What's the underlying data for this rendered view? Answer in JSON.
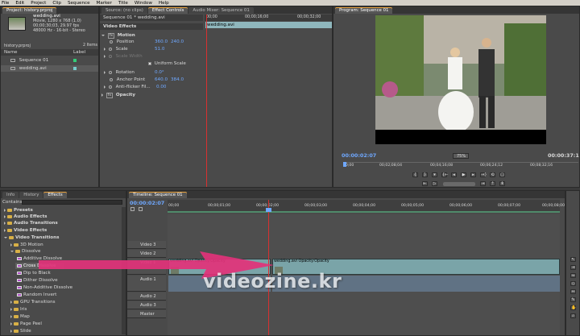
{
  "menu": [
    "File",
    "Edit",
    "Project",
    "Clip",
    "Sequence",
    "Marker",
    "Title",
    "Window",
    "Help"
  ],
  "project": {
    "tab": "Project: history.prproj",
    "clip_name": "wedding.avi",
    "clip_info": [
      "Movie, 1280 x 768 (1.0)",
      "00;00;30;03, 29.97 fps",
      "48000 Hz - 16-bit - Stereo"
    ],
    "item_count": "2 Items",
    "folder": "history.prproj",
    "col_name": "Name",
    "col_label": "Label",
    "items": [
      "Sequence 01",
      "wedding.avi"
    ]
  },
  "effect_controls": {
    "tabs": [
      "Source: (no clips)",
      "Effect Controls",
      "Audio Mixer: Sequence 01"
    ],
    "clip": "Sequence 01 * wedding.avi",
    "ruler": [
      "00;00",
      "00;00;16;00",
      "00;00;32;00"
    ],
    "clip_bar": "wedding.avi",
    "section": "Video Effects",
    "motion": "Motion",
    "position_label": "Position",
    "position_x": "360.0",
    "position_y": "240.0",
    "scale_label": "Scale",
    "scale_value": "51.0",
    "scale_width_label": "Scale Width",
    "uniform_scale": "Uniform Scale",
    "rotation_label": "Rotation",
    "rotation_value": "0.0°",
    "anchor_label": "Anchor Point",
    "anchor_x": "640.0",
    "anchor_y": "384.0",
    "flicker_label": "Anti-flicker Fil...",
    "flicker_value": "0.00",
    "opacity": "Opacity"
  },
  "program": {
    "tab": "Program: Sequence 01",
    "timecode": "00:00:02:07",
    "zoom": "75%",
    "duration": "00:00:37:11",
    "ruler": [
      "00;00",
      "00;02;08;04",
      "00;04;16;08",
      "00;06;24;12",
      "00;08;32;16"
    ]
  },
  "effects": {
    "tabs": [
      "Info",
      "History",
      "Effects"
    ],
    "contains": "Contains:",
    "items": [
      "Presets",
      "Audio Effects",
      "Audio Transitions",
      "Video Effects",
      "Video Transitions",
      "3D Motion",
      "Dissolve",
      "Additive Dissolve",
      "Cross Dissolve",
      "Dip to Black",
      "Dither Dissolve",
      "Non-Additive Dissolve",
      "Random Invert",
      "GPU Transitions",
      "Iris",
      "Map",
      "Page Peel",
      "Slide"
    ]
  },
  "timeline": {
    "tab": "Timeline: Sequence 01",
    "timecode": "00:00:02:07",
    "ruler": [
      "00;00",
      "00;00;01;00",
      "00;00;02;00",
      "00;00;03;00",
      "00;00;04;00",
      "00;00;05;00",
      "00;00;06;00",
      "00;00;07;00",
      "00;00;08;00"
    ],
    "tracks": [
      "Video 3",
      "Video 2",
      "Video 1",
      "Audio 1",
      "Audio 2",
      "Audio 3",
      "Master"
    ],
    "clip_a": "wedding.avi Opacity:Opacity",
    "clip_b": "wedding.avi Opacity:Opacity"
  },
  "watermark": "videozine.kr",
  "colors": {
    "accent_blue": "#6fa8ff",
    "accent_yellow": "#e6b11f",
    "playhead": "#d83030",
    "arrow": "#e2327a",
    "clip": "#7aa4a8"
  }
}
